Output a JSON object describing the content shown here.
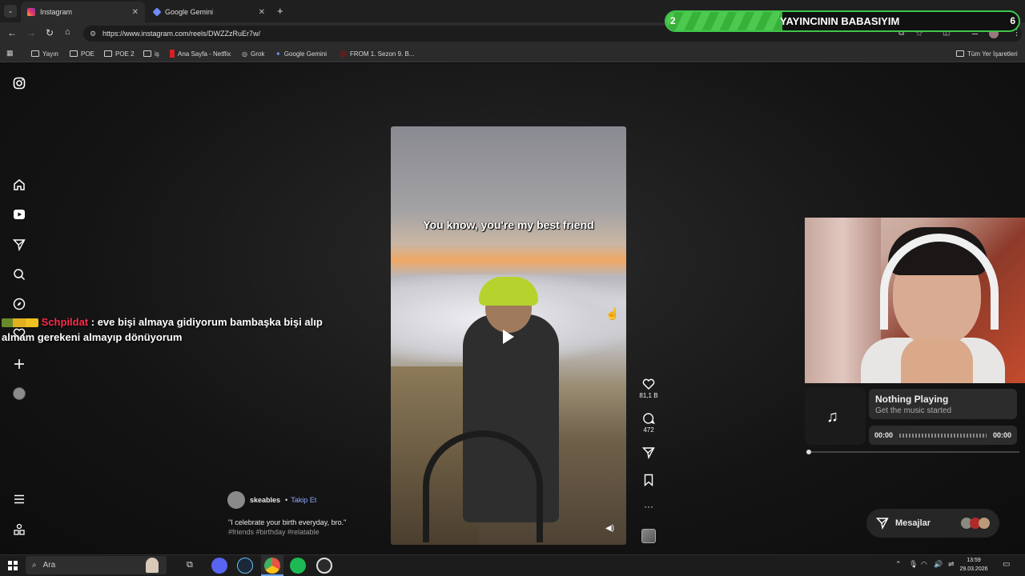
{
  "browser": {
    "tabs": [
      {
        "label": "Instagram",
        "active": true
      },
      {
        "label": "Google Gemini",
        "active": false
      }
    ],
    "url": "https://www.instagram.com/reels/DWZZzRuEr7w/",
    "bookmarks": [
      "Yayın",
      "POE",
      "POE 2",
      "iş",
      "Ana Sayfa - Netflix",
      "Grok",
      "Google Gemini",
      "FROM 1. Sezon 9. B..."
    ],
    "all_bookmarks": "Tüm Yer İşaretleri"
  },
  "goal": {
    "left": "2",
    "title": "YAYINCININ BABASIYIM",
    "right": "6",
    "progress_fraction": 0.33
  },
  "reel": {
    "subtitle": "You know, you're my best friend",
    "likes": "81,1 B",
    "comments": "472",
    "author": "skeables",
    "follow": "Takip Et",
    "separator": "•",
    "caption": "\"I celebrate your birth everyday, bro.\"",
    "hashtags": "#friends #birthday #relatable"
  },
  "chat": {
    "user": "Schpildat",
    "message": ": eve bişi almaya gidiyorum bambaşka bişi alıp almam gerekeni almayıp dönüyorum"
  },
  "music": {
    "title": "Nothing Playing",
    "subtitle": "Get the music started",
    "time_start": "00:00",
    "time_end": "00:00"
  },
  "messages": {
    "label": "Mesajlar"
  },
  "taskbar": {
    "search_placeholder": "Ara",
    "time": "13:59",
    "date": "29.03.2026"
  },
  "colors": {
    "goal_green": "#3ec74a",
    "chat_user": "#ff2a4a",
    "follow_blue": "#8ea8ff"
  }
}
